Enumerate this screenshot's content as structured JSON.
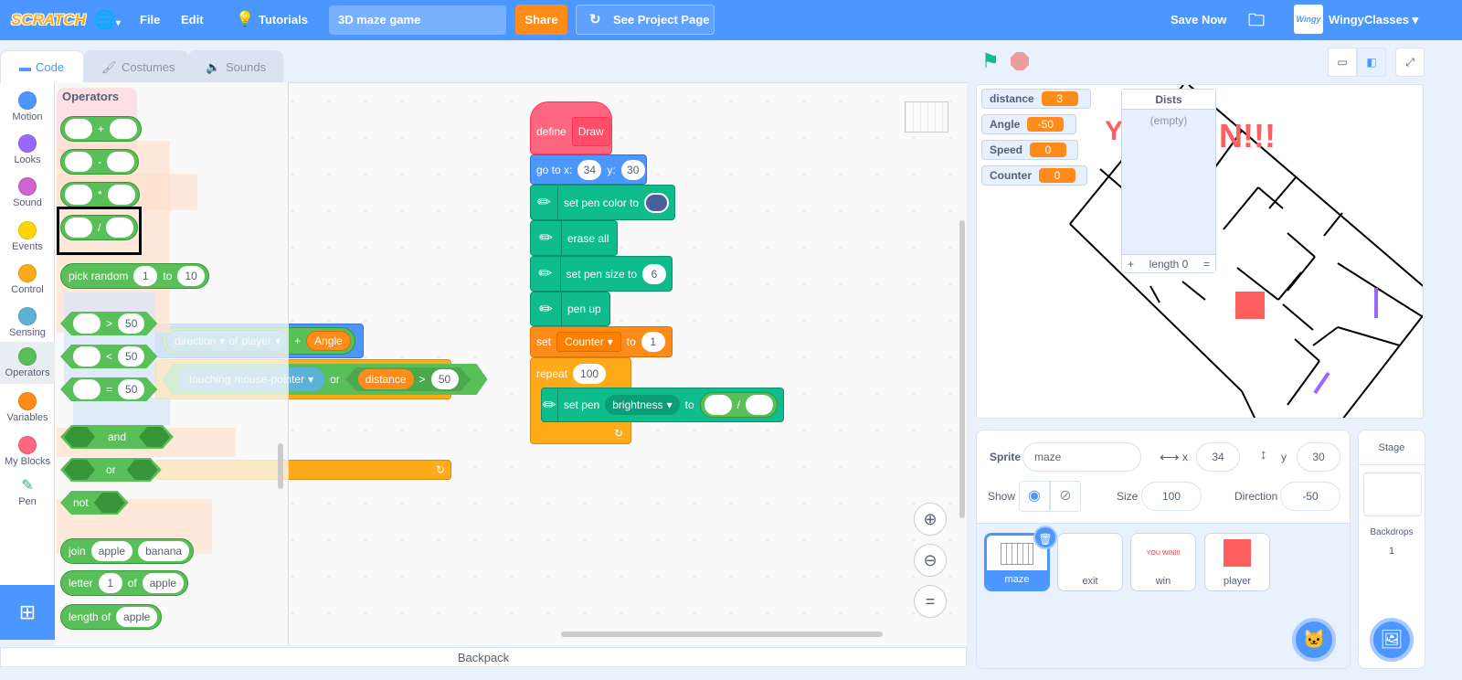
{
  "menubar": {
    "logo": "SCRATCH",
    "file": "File",
    "edit": "Edit",
    "tutorials": "Tutorials",
    "project_title": "3D maze game",
    "share": "Share",
    "see_project_page": "See Project Page",
    "save_now": "Save Now",
    "username": "WingyClasses",
    "avatar_text": "Wingy"
  },
  "tabs": [
    {
      "label": "Code"
    },
    {
      "label": "Costumes"
    },
    {
      "label": "Sounds"
    }
  ],
  "categories": [
    {
      "label": "Motion",
      "color": "#4c97ff"
    },
    {
      "label": "Looks",
      "color": "#9966ff"
    },
    {
      "label": "Sound",
      "color": "#cf63cf"
    },
    {
      "label": "Events",
      "color": "#ffd500"
    },
    {
      "label": "Control",
      "color": "#ffab19"
    },
    {
      "label": "Sensing",
      "color": "#5cb1d6"
    },
    {
      "label": "Operators",
      "color": "#59c059"
    },
    {
      "label": "Variables",
      "color": "#ff8c1a"
    },
    {
      "label": "My Blocks",
      "color": "#ff6680"
    },
    {
      "label": "Pen",
      "color": "#0fbd8c"
    }
  ],
  "palette": {
    "heading": "Operators",
    "add": "+",
    "sub": "-",
    "mul": "*",
    "div": "/",
    "pick_random": "pick random",
    "to": "to",
    "rand_from": "1",
    "rand_to": "10",
    "gt": ">",
    "lt": "<",
    "eq": "=",
    "cmp_value": "50",
    "and": "and",
    "or": "or",
    "not": "not",
    "join": "join",
    "join_a": "apple",
    "join_b": "banana",
    "letter": "letter",
    "letter_n": "1",
    "of": "of",
    "letter_s": "apple",
    "length_of": "length of",
    "length_s": "apple"
  },
  "script": {
    "define": "define",
    "define_name": "Draw",
    "goto": "go to x:",
    "goto_x": "34",
    "goto_y_label": "y:",
    "goto_y": "30",
    "set_pen_color": "set pen color to",
    "pen_color": "#4a5f9c",
    "erase_all": "erase all",
    "set_pen_size": "set pen size to",
    "pen_size": "6",
    "pen_up": "pen up",
    "set": "set",
    "set_var": "Counter",
    "set_to": "to",
    "set_value": "1",
    "repeat": "repeat",
    "repeat_count": "100",
    "set_pen": "set pen",
    "pen_param": "brightness",
    "pen_to": "to",
    "div": "/"
  },
  "dragged": {
    "direction": "direction",
    "of": "of",
    "player": "player",
    "plus": "+",
    "angle": "Angle",
    "touching": "touching",
    "mouse_pointer": "mouse-pointer",
    "or": "or",
    "distance": "distance",
    "gt": ">",
    "value": "50"
  },
  "backpack": "Backpack",
  "stage": {
    "monitors": [
      {
        "name": "distance",
        "value": "3"
      },
      {
        "name": "Angle",
        "value": "-50"
      },
      {
        "name": "Speed",
        "value": "0"
      },
      {
        "name": "Counter",
        "value": "0"
      }
    ],
    "list": {
      "name": "Dists",
      "empty": "(empty)",
      "add": "+",
      "length": "length 0",
      "resize": "="
    }
  },
  "sprite_info": {
    "sprite_label": "Sprite",
    "sprite_name": "maze",
    "x_label": "x",
    "x": "34",
    "y_label": "y",
    "y": "30",
    "show_label": "Show",
    "size_label": "Size",
    "size": "100",
    "direction_label": "Direction",
    "direction": "-50"
  },
  "sprites": [
    {
      "name": "maze",
      "selected": true
    },
    {
      "name": "exit"
    },
    {
      "name": "win",
      "thumb_text": "YOU WIN!!!"
    },
    {
      "name": "player"
    }
  ],
  "stage_pane": {
    "title": "Stage",
    "backdrops_label": "Backdrops",
    "backdrops": "1"
  }
}
